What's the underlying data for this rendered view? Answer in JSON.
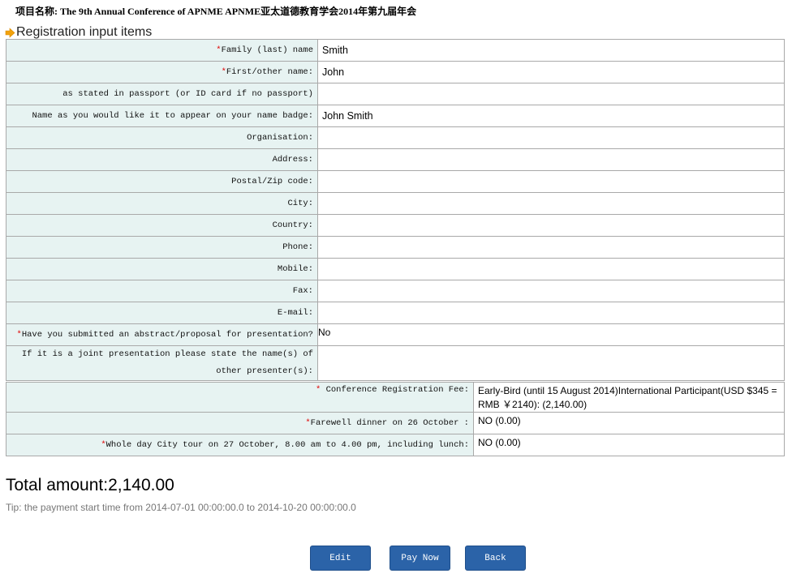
{
  "project": {
    "title": "项目名称:  The 9th Annual Conference of APNME APNME亚太道德教育学会2014年第九届年会"
  },
  "section": {
    "heading": "Registration input items",
    "icon": "arrow-right-icon"
  },
  "colors": {
    "label_bg": "#e7f3f2",
    "border": "#a9a9a9",
    "required": "#e00000",
    "button_bg": "#2b63a8",
    "arrow": "#f2a20c"
  },
  "fields": {
    "family_name": {
      "required": "*",
      "label": "Family (last) name",
      "value": "Smith"
    },
    "first_name": {
      "required": "*",
      "label": "First/other name:",
      "value": "John"
    },
    "passport_note": {
      "label": "as stated in passport (or ID card if no passport)",
      "value": ""
    },
    "badge_name": {
      "label": "Name as you would like it to appear on your name badge:",
      "value": "John Smith"
    },
    "organisation": {
      "label": "Organisation:",
      "value": ""
    },
    "address": {
      "label": "Address:",
      "value": ""
    },
    "postal_code": {
      "label": "Postal/Zip code:",
      "value": ""
    },
    "city": {
      "label": "City:",
      "value": ""
    },
    "country": {
      "label": "Country:",
      "value": ""
    },
    "phone": {
      "label": "Phone:",
      "value": ""
    },
    "mobile": {
      "label": "Mobile:",
      "value": ""
    },
    "fax": {
      "label": "Fax:",
      "value": ""
    },
    "email": {
      "label": "E-mail:",
      "value": ""
    },
    "abstract": {
      "required": "*",
      "label": "Have you submitted an abstract/proposal for presentation?",
      "value": "No"
    },
    "joint_presenters": {
      "label": "If it is a joint presentation please state the name(s) of other presenter(s):",
      "value": ""
    }
  },
  "fees": {
    "registration": {
      "required": "*",
      "label": " Conference Registration Fee:",
      "value": "Early-Bird (until 15 August 2014)International Participant(USD $345 = RMB ￥2140): (2,140.00)"
    },
    "farewell": {
      "required": "*",
      "label": "Farewell dinner on 26 October :",
      "value": "NO (0.00)"
    },
    "city_tour": {
      "required": "*",
      "label": "Whole day City tour on 27 October, 8.00 am to 4.00 pm, including lunch:",
      "value": "NO (0.00)"
    }
  },
  "total": {
    "text": "Total amount:2,140.00"
  },
  "tip": {
    "text": "Tip: the payment start time from 2014-07-01 00:00:00.0 to 2014-10-20 00:00:00.0"
  },
  "buttons": {
    "edit": "Edit",
    "pay_now": "Pay Now",
    "back": "Back"
  }
}
